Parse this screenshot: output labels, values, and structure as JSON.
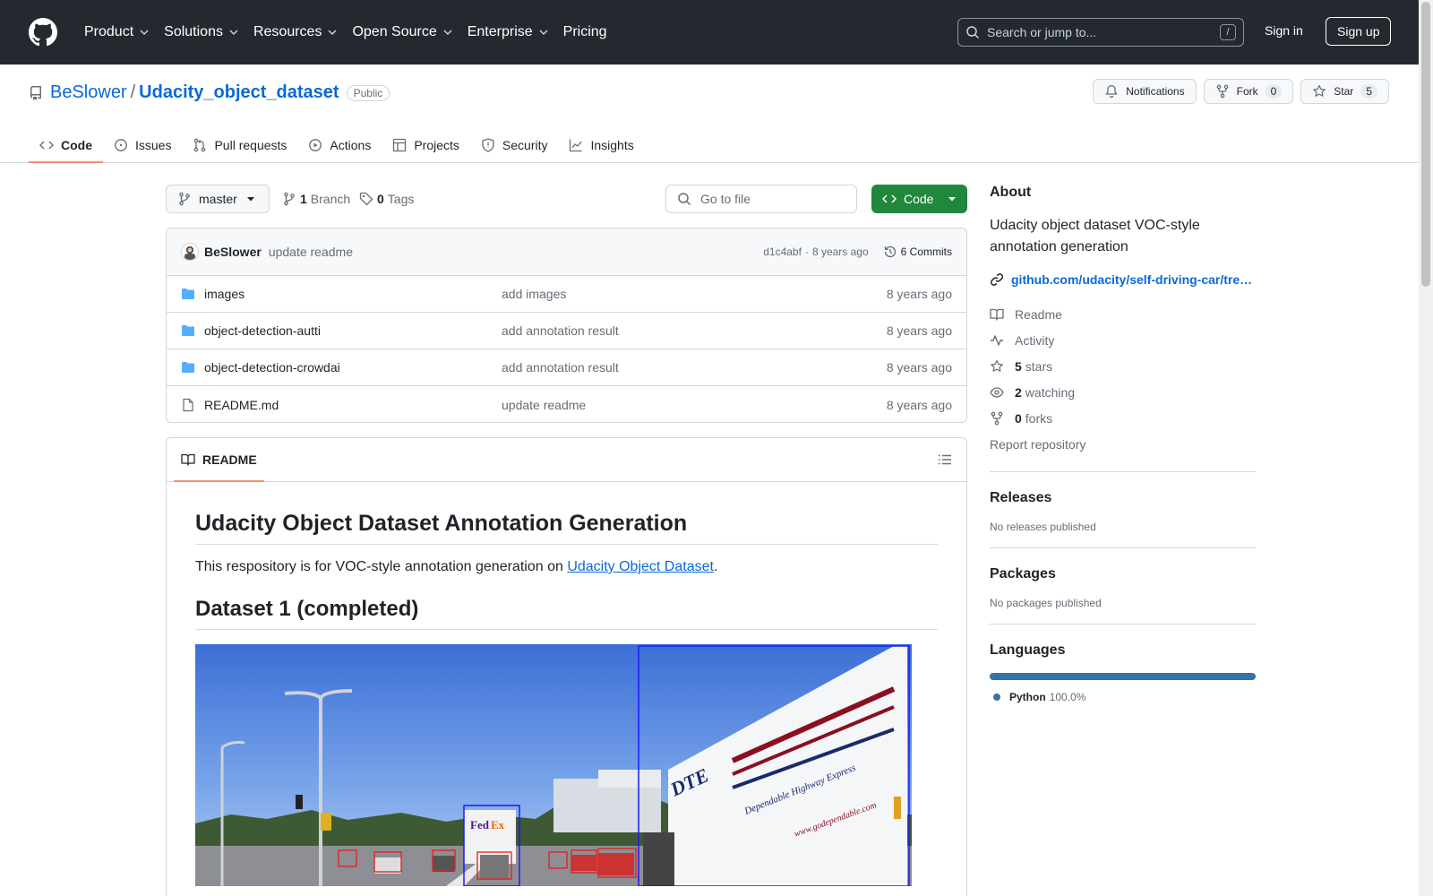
{
  "header": {
    "nav": [
      "Product",
      "Solutions",
      "Resources",
      "Open Source",
      "Enterprise",
      "Pricing"
    ],
    "search_placeholder": "Search or jump to...",
    "search_shortcut": "/",
    "sign_in": "Sign in",
    "sign_up": "Sign up"
  },
  "repo": {
    "owner": "BeSlower",
    "separator": "/",
    "name": "Udacity_object_dataset",
    "visibility": "Public",
    "notifications_label": "Notifications",
    "fork_label": "Fork",
    "fork_count": "0",
    "star_label": "Star",
    "star_count": "5",
    "tabs": [
      "Code",
      "Issues",
      "Pull requests",
      "Actions",
      "Projects",
      "Security",
      "Insights"
    ]
  },
  "toolbar": {
    "branch": "master",
    "branch_count": "1",
    "branch_label": "Branch",
    "tag_count": "0",
    "tag_label": "Tags",
    "goto_placeholder": "Go to file",
    "code_button": "Code"
  },
  "commit": {
    "author": "BeSlower",
    "message": "update readme",
    "hash": "d1c4abf",
    "dot": "·",
    "time": "8 years ago",
    "commits_label": "6 Commits"
  },
  "files": [
    {
      "name": "images",
      "type": "dir",
      "message": "add images",
      "time": "8 years ago"
    },
    {
      "name": "object-detection-autti",
      "type": "dir",
      "message": "add annotation result",
      "time": "8 years ago"
    },
    {
      "name": "object-detection-crowdai",
      "type": "dir",
      "message": "add annotation result",
      "time": "8 years ago"
    },
    {
      "name": "README.md",
      "type": "file",
      "message": "update readme",
      "time": "8 years ago"
    }
  ],
  "readme": {
    "tab_label": "README",
    "h1": "Udacity Object Dataset Annotation Generation",
    "p_before": "This respository is for VOC-style annotation generation on ",
    "p_link": "Udacity Object Dataset",
    "p_after": ".",
    "h2": "Dataset 1 (completed)",
    "image_texts": {
      "truck_logo": "DTE",
      "truck_slogan": "Dependable Highway Express",
      "truck_url": "www.godependable.com",
      "van_logo_fed": "Fed",
      "van_logo_ex": "Ex"
    }
  },
  "sidebar": {
    "about_title": "About",
    "description": "Udacity object dataset VOC-style annotation generation",
    "link": "github.com/udacity/self-driving-car/tre…",
    "readme": "Readme",
    "activity": "Activity",
    "stars_count": "5",
    "stars_label": "stars",
    "watching_count": "2",
    "watching_label": "watching",
    "forks_count": "0",
    "forks_label": "forks",
    "report": "Report repository",
    "releases_title": "Releases",
    "releases_empty": "No releases published",
    "packages_title": "Packages",
    "packages_empty": "No packages published",
    "languages_title": "Languages",
    "language_name": "Python",
    "language_pct": "100.0%",
    "language_color": "#3572a5"
  },
  "colors": {
    "header_bg": "#24292f",
    "link": "#0969da",
    "code_button": "#1f883d",
    "tab_underline": "#fd8c73",
    "folder": "#54aeff"
  }
}
